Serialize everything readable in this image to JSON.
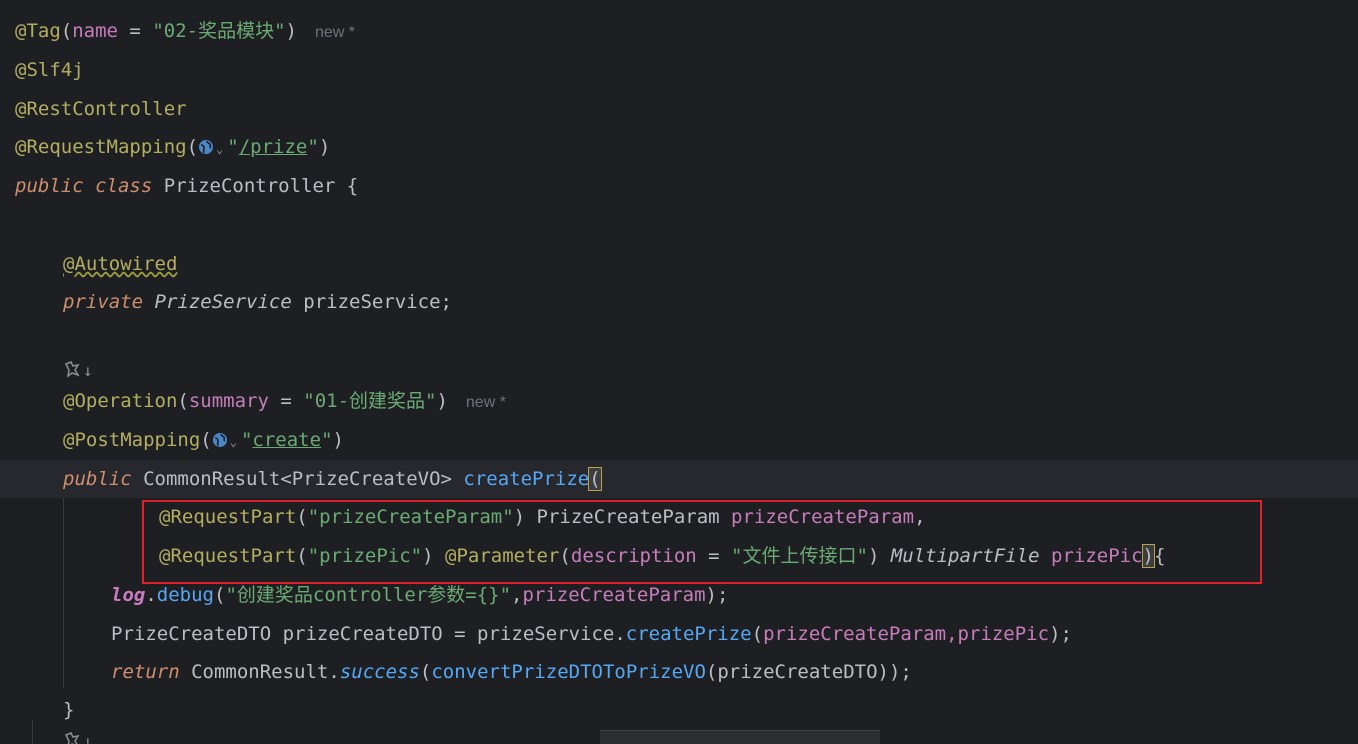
{
  "code": {
    "line1": {
      "annotation": "@Tag",
      "open": "(",
      "param": "name",
      "eq": " = ",
      "value": "\"02-奖品模块\"",
      "close": ")",
      "hint": "new *"
    },
    "line2": {
      "annotation": "@Slf4j"
    },
    "line3": {
      "annotation": "@RestController"
    },
    "line4": {
      "annotation": "@RequestMapping",
      "open": "(",
      "chevron": "⌄",
      "value_open": "\"",
      "value": "/prize",
      "value_close": "\"",
      "close": ")"
    },
    "line5": {
      "kw1": "public",
      "kw2": "class",
      "name": "PrizeController",
      "brace": " {"
    },
    "line7": {
      "annotation": "@Autowired"
    },
    "line8": {
      "kw": "private",
      "type": "PrizeService",
      "name": " prizeService;"
    },
    "line9": {
      "icon_hint": "↓"
    },
    "line10": {
      "annotation": "@Operation",
      "open": "(",
      "param": "summary",
      "eq": " = ",
      "value": "\"01-创建奖品\"",
      "close": ")",
      "hint": "new *"
    },
    "line11": {
      "annotation": "@PostMapping",
      "open": "(",
      "chevron": "⌄",
      "value_open": "\"",
      "value": "create",
      "value_close": "\"",
      "close": ")"
    },
    "line12": {
      "kw": "public",
      "type": "CommonResult<PrizeCreateVO>",
      "fn": "createPrize",
      "paren": "("
    },
    "line13": {
      "annotation": "@RequestPart",
      "open": "(",
      "value": "\"prizeCreateParam\"",
      "close": ")",
      "type": "PrizeCreateParam",
      "name": "prizeCreateParam",
      "comma": ","
    },
    "line14": {
      "annotation1": "@RequestPart",
      "open1": "(",
      "value1": "\"prizePic\"",
      "close1": ")",
      "annotation2": "@Parameter",
      "open2": "(",
      "param": "description",
      "eq": " = ",
      "value2": "\"文件上传接口\"",
      "close2": ")",
      "type": "MultipartFile",
      "name": "prizePic",
      "paren": ")",
      "brace": "{"
    },
    "line15": {
      "field": "log",
      "dot": ".",
      "fn": "debug",
      "open": "(",
      "value": "\"创建奖品controller参数={}\"",
      "comma": ",",
      "arg": "prizeCreateParam",
      "close": ");"
    },
    "line16": {
      "type": "PrizeCreateDTO",
      "var": " prizeCreateDTO = prizeService",
      "dot": ".",
      "fn": "createPrize",
      "open": "(",
      "args": "prizeCreateParam,prizePic",
      "close": ");"
    },
    "line17": {
      "kw": "return",
      "type": "CommonResult",
      "dot": ".",
      "fn": "success",
      "open": "(",
      "fn2": "convertPrizeDTOToPrizeVO",
      "open2": "(",
      "arg": "prizeCreateDTO",
      "close": "));"
    },
    "line18": {
      "brace": "}"
    },
    "line19": {
      "icon_hint": "↓"
    }
  },
  "colors": {
    "background": "#1e1f22",
    "annotation": "#b3ae60",
    "keyword": "#cf8e6d",
    "string": "#6aab73",
    "param": "#c77dbb",
    "function": "#56a8f5",
    "highlight_border": "#e0202a"
  },
  "icons": {
    "globe": "globe-icon",
    "ai_gutter": "ai-gutter-icon"
  }
}
